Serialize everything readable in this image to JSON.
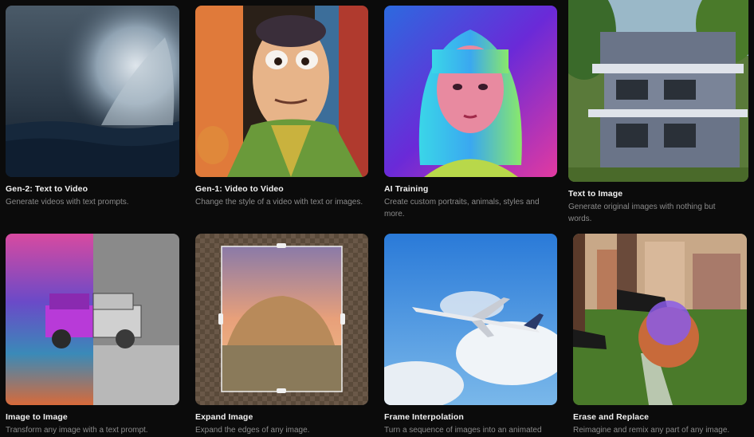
{
  "cards": [
    {
      "title": "Gen-2: Text to Video",
      "desc": "Generate videos with text prompts."
    },
    {
      "title": "Gen-1: Video to Video",
      "desc": "Change the style of a video with text or images."
    },
    {
      "title": "AI Training",
      "desc": "Create custom portraits, animals, styles and more."
    },
    {
      "title": "Text to Image",
      "desc": "Generate original images with nothing but words."
    },
    {
      "title": "Image to Image",
      "desc": "Transform any image with a text prompt."
    },
    {
      "title": "Expand Image",
      "desc": "Expand the edges of any image."
    },
    {
      "title": "Frame Interpolation",
      "desc": "Turn a sequence of images into an animated"
    },
    {
      "title": "Erase and Replace",
      "desc": "Reimagine and remix any part of any image."
    }
  ]
}
